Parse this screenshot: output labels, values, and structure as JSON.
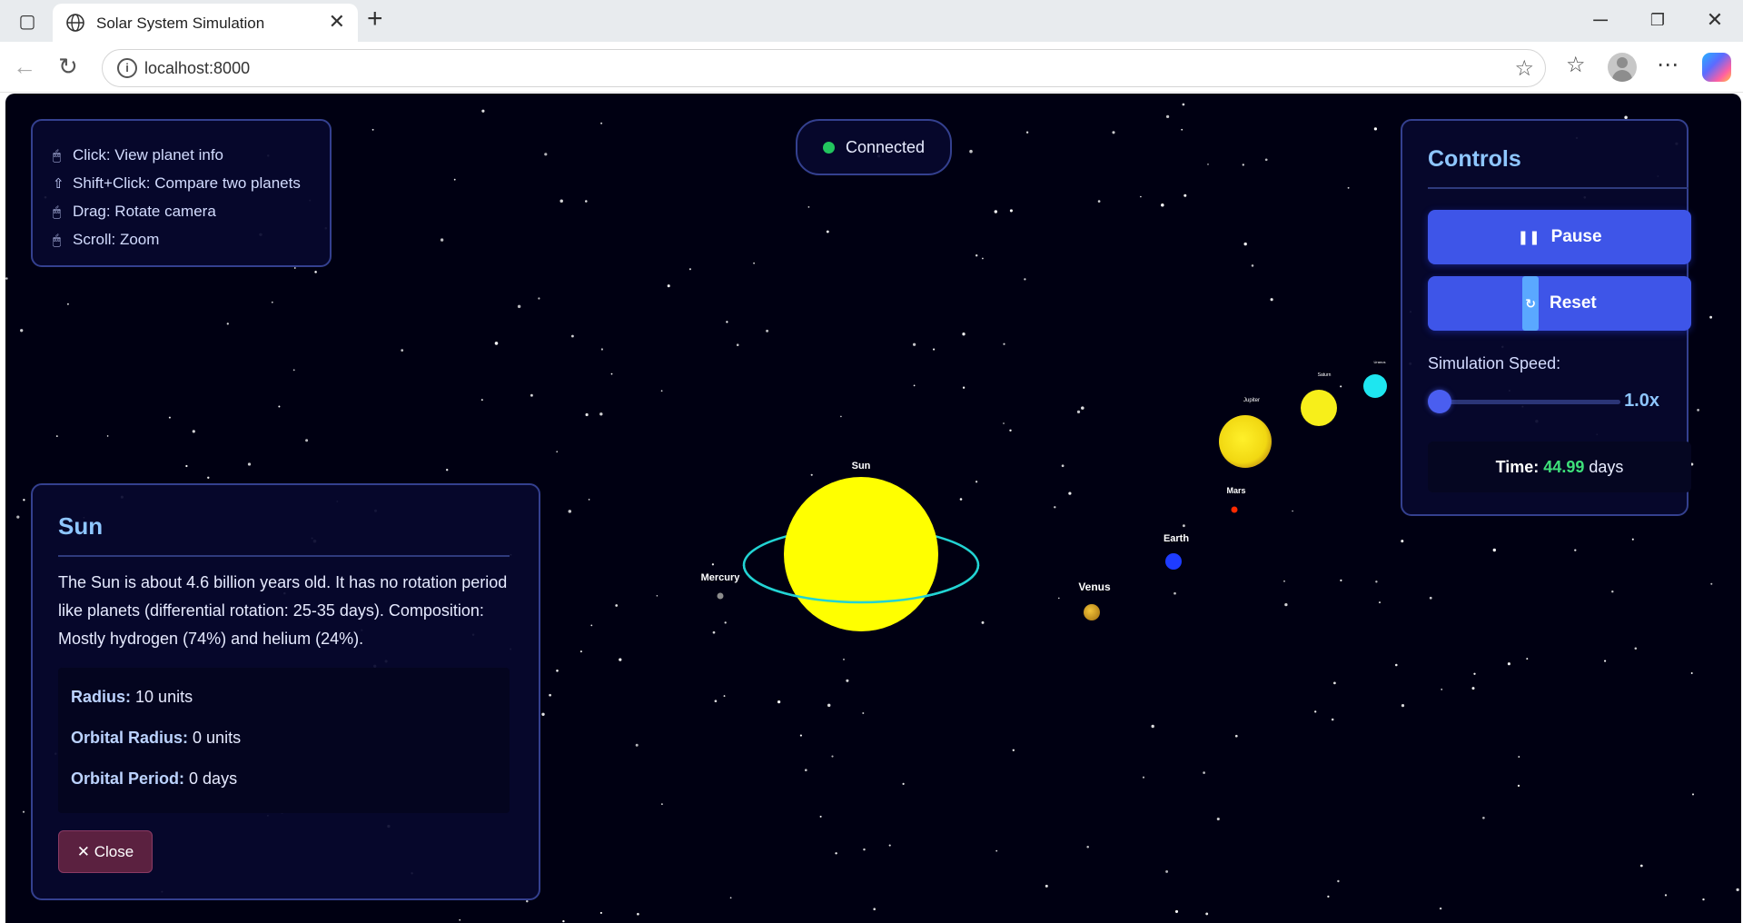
{
  "browser": {
    "tab_title": "Solar System Simulation",
    "url": "localhost:8000"
  },
  "help": {
    "items": [
      {
        "glyph": "🖱",
        "text": "Click: View planet info"
      },
      {
        "glyph": "⇧",
        "text": "Shift+Click: Compare two planets"
      },
      {
        "glyph": "🖱",
        "text": "Drag: Rotate camera"
      },
      {
        "glyph": "🖱",
        "text": "Scroll: Zoom"
      }
    ]
  },
  "status": {
    "text": "Connected",
    "color": "#22c55e"
  },
  "controls": {
    "title": "Controls",
    "pause_label": "Pause",
    "reset_label": "Reset",
    "speed_label": "Simulation Speed:",
    "speed_value": "1.0x",
    "speed_fraction": 0.0,
    "time_label": "Time:",
    "time_value": "44.99",
    "time_unit": "days"
  },
  "info": {
    "title": "Sun",
    "description": "The Sun is about 4.6 billion years old. It has no rotation period like planets (differential rotation: 25-35 days). Composition: Mostly hydrogen (74%) and helium (24%).",
    "radius_label": "Radius:",
    "radius_value": "10 units",
    "orbital_radius_label": "Orbital Radius:",
    "orbital_radius_value": "0 units",
    "orbital_period_label": "Orbital Period:",
    "orbital_period_value": "0 days",
    "close_label": "✕ Close"
  },
  "scene": {
    "bodies": [
      {
        "name": "Sun",
        "color": "#ffff00"
      },
      {
        "name": "Mercury",
        "color": "#8c8c8c"
      },
      {
        "name": "Venus",
        "color": "#d9a520"
      },
      {
        "name": "Earth",
        "color": "#1e3cff"
      },
      {
        "name": "Mars",
        "color": "#ff2a00"
      },
      {
        "name": "Jupiter",
        "color": "#f2de10"
      },
      {
        "name": "Saturn",
        "color": "#f7ef1a"
      },
      {
        "name": "Uranus",
        "color": "#1ee6f0"
      }
    ],
    "selection_ring_color": "#22d3d3"
  }
}
